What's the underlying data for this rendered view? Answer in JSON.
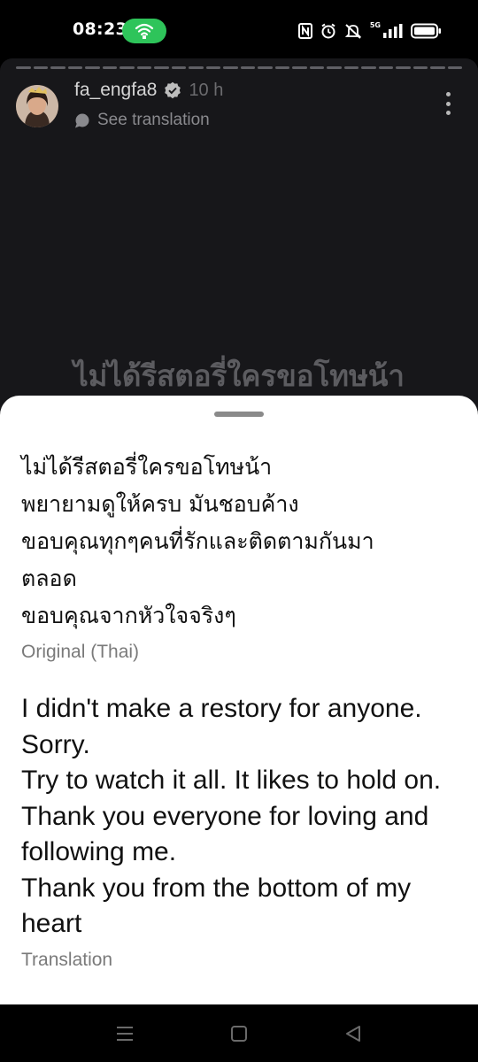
{
  "status_bar": {
    "time": "08:23",
    "network_label": "5G",
    "icons": [
      "hotspot-icon",
      "nfc-icon",
      "alarm-icon",
      "mute-icon",
      "signal-icon",
      "battery-icon"
    ],
    "hotspot_color": "#2ec45a"
  },
  "story": {
    "username": "fa_engfa8",
    "verified": true,
    "post_time": "10 h",
    "see_translation_label": "See translation",
    "overlay_text": "ไม่ได้รีสตอรี่ใครขอโทษน้า",
    "progress_segments": 26,
    "background_color": "#17171a"
  },
  "translation_sheet": {
    "original_lines": [
      "ไม่ได้รีสตอรี่ใครขอโทษน้า",
      "พยายามดูให้ครบ มันชอบค้าง",
      "ขอบคุณทุกๆคนที่รักและติดตามกันมา",
      "ตลอด",
      "ขอบคุณจากหัวใจจริงๆ"
    ],
    "original_caption": "Original (Thai)",
    "translated_lines": [
      "I didn't make a restory for anyone.",
      "Sorry.",
      "Try to watch it all. It likes to hold on.",
      "Thank you everyone for loving and",
      "following me.",
      "Thank you from the bottom of my",
      "heart"
    ],
    "translated_caption": "Translation"
  },
  "nav_bar": {
    "buttons": [
      "menu-icon",
      "home-icon",
      "back-icon"
    ]
  }
}
